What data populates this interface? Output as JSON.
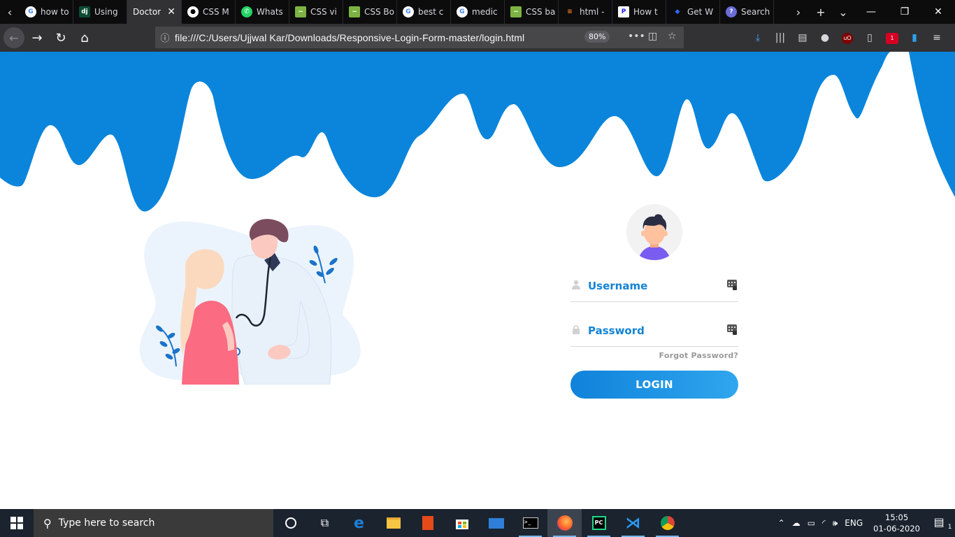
{
  "browser": {
    "tabs": [
      {
        "label": "how to",
        "icon": "google-icon",
        "active": false
      },
      {
        "label": "Using",
        "icon": "django-icon",
        "active": false
      },
      {
        "label": "Doctor",
        "icon": "none",
        "active": true
      },
      {
        "label": "CSS M",
        "icon": "github-icon",
        "active": false
      },
      {
        "label": "Whats",
        "icon": "whatsapp-icon",
        "active": false
      },
      {
        "label": "CSS vi",
        "icon": "codepen-icon",
        "active": false
      },
      {
        "label": "CSS Bo",
        "icon": "codepen-icon",
        "active": false
      },
      {
        "label": "best c",
        "icon": "google-icon",
        "active": false
      },
      {
        "label": "medic",
        "icon": "google-icon",
        "active": false
      },
      {
        "label": "CSS ba",
        "icon": "codepen-icon",
        "active": false
      },
      {
        "label": "html -",
        "icon": "stackoverflow-icon",
        "active": false
      },
      {
        "label": "How t",
        "icon": "pinterest-icon",
        "active": false
      },
      {
        "label": "Get W",
        "icon": "weebly-icon",
        "active": false
      },
      {
        "label": "Search",
        "icon": "search-engine-icon",
        "active": false
      }
    ],
    "url": "file:///C:/Users/Ujjwal Kar/Downloads/Responsive-Login-Form-master/login.html",
    "zoom": "80%",
    "container_badge": "1"
  },
  "login": {
    "username_label": "Username",
    "password_label": "Password",
    "forgot_text": "Forgot Password?",
    "button_label": "LOGIN"
  },
  "colors": {
    "wave": "#0a85db",
    "accent": "#1483d4",
    "button_start": "#1082da",
    "button_end": "#2fa6ee"
  },
  "taskbar": {
    "search_placeholder": "Type here to search",
    "language": "ENG",
    "time": "15:05",
    "date": "01-06-2020",
    "notification_count": "1"
  }
}
